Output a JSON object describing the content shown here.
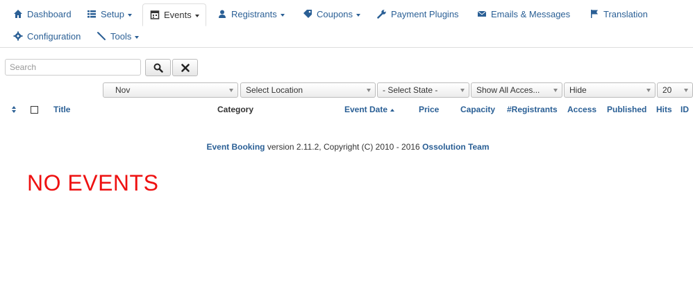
{
  "nav": {
    "dashboard": "Dashboard",
    "setup": "Setup",
    "events": "Events",
    "registrants": "Registrants",
    "coupons": "Coupons",
    "payment_plugins": "Payment Plugins",
    "emails_messages": "Emails & Messages",
    "translation": "Translation",
    "configuration": "Configuration",
    "tools": "Tools"
  },
  "search": {
    "placeholder": "Search",
    "value": ""
  },
  "filters": {
    "month": "Nov",
    "location": "Select Location",
    "state": "- Select State -",
    "access": "Show All Acces...",
    "hide": "Hide",
    "limit": "20"
  },
  "table": {
    "headers": {
      "title": "Title",
      "category": "Category",
      "event_date": "Event Date",
      "price": "Price",
      "capacity": "Capacity",
      "registrants": "#Registrants",
      "access": "Access",
      "published": "Published",
      "hits": "Hits",
      "id": "ID"
    }
  },
  "footer": {
    "product": "Event Booking",
    "middle": " version 2.11.2, Copyright (C) 2010 - 2016 ",
    "company": "Ossolution Team"
  },
  "empty_message": "NO EVENTS",
  "colors": {
    "link": "#2a5f95",
    "empty": "#ee1111"
  },
  "icons": [
    "home-icon",
    "list-icon",
    "calendar-icon",
    "user-icon",
    "tag-icon",
    "wrench-icon",
    "envelope-icon",
    "flag-icon",
    "gear-icon",
    "tools-icon",
    "search-icon",
    "close-icon"
  ]
}
